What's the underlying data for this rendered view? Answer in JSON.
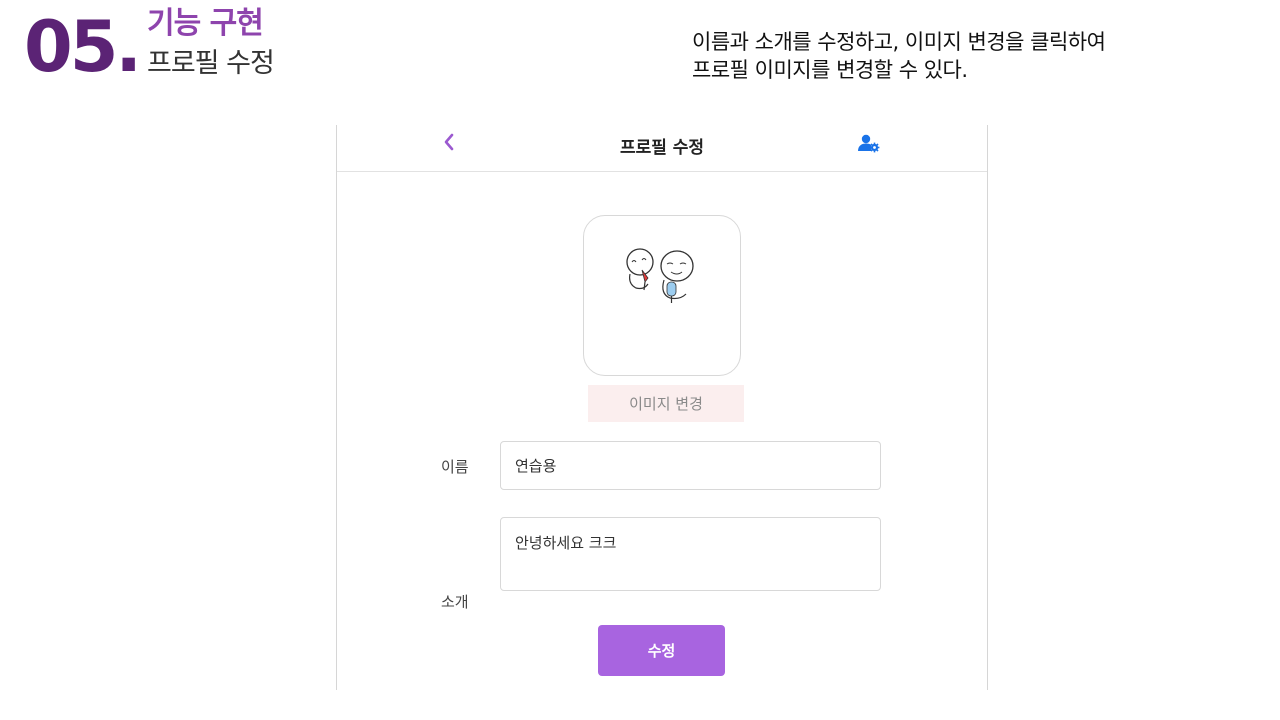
{
  "slide": {
    "number": "05.",
    "title": "기능 구현",
    "subtitle": "프로필 수정",
    "description_line1": "이름과 소개를 수정하고, 이미지 변경을 클릭하여",
    "description_line2": "프로필 이미지를 변경할 수 있다."
  },
  "app": {
    "topbar": {
      "title": "프로필 수정",
      "back_icon": "chevron-left-icon",
      "settings_icon": "user-settings-icon"
    },
    "profile_image_button_label": "이미지 변경",
    "form": {
      "name_label": "이름",
      "name_value": "연습용",
      "intro_label": "소개",
      "intro_value": "안녕하세요 크크",
      "submit_label": "수정"
    },
    "colors": {
      "accent": "#a864e0",
      "icon_purple": "#9b59d0",
      "icon_blue": "#1a73e8",
      "image_button_bg": "#fbeeee"
    }
  }
}
